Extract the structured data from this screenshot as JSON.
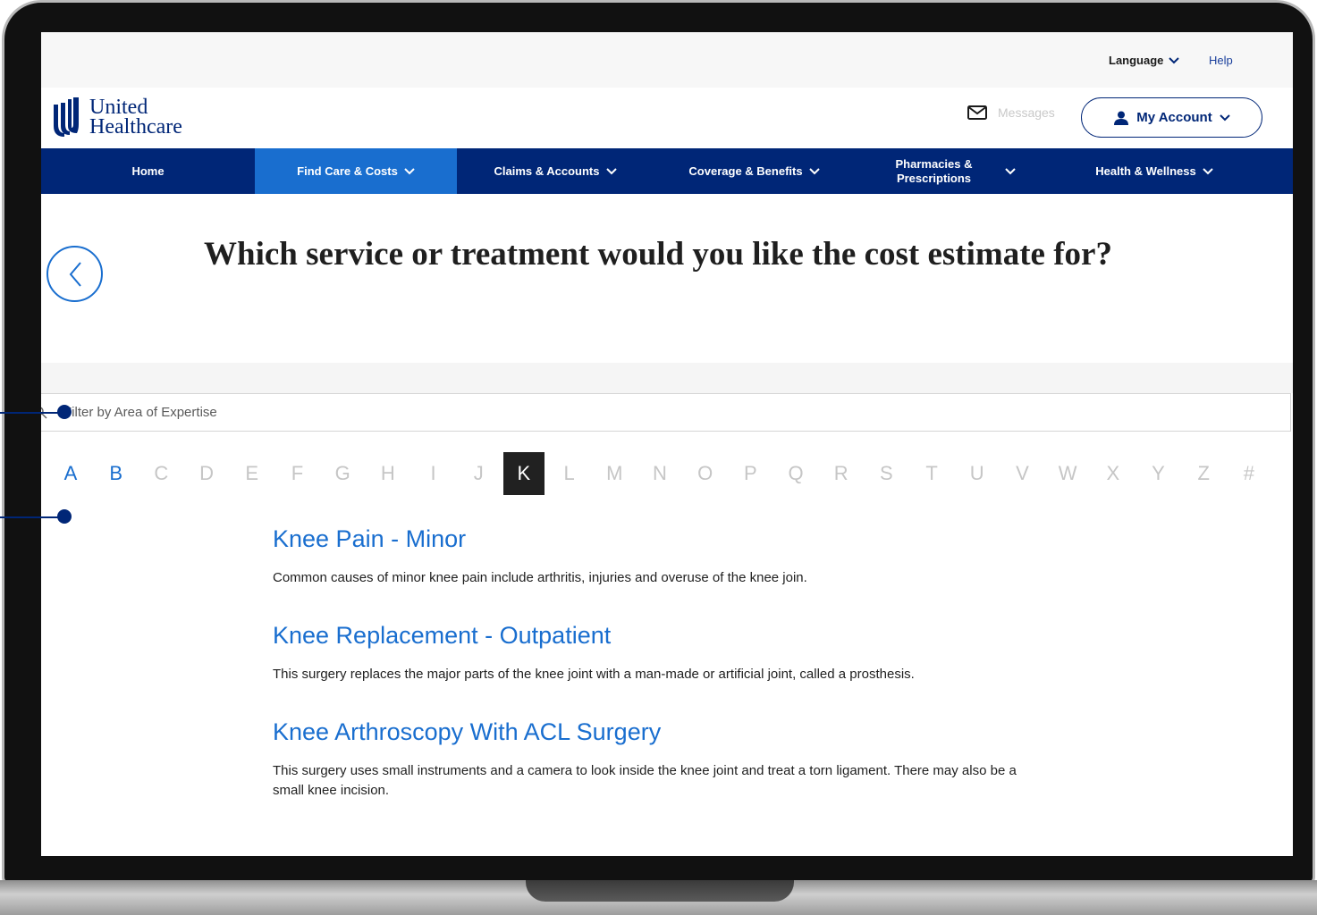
{
  "utility": {
    "language_label": "Language",
    "help_label": "Help"
  },
  "header": {
    "logo_line1": "United",
    "logo_line2": "Healthcare",
    "messages_label": "Messages",
    "account_label": "My Account"
  },
  "nav": {
    "items": [
      {
        "label": "Home"
      },
      {
        "label": "Find Care & Costs"
      },
      {
        "label": "Claims & Accounts"
      },
      {
        "label": "Coverage & Benefits"
      },
      {
        "label_line1": "Pharmacies &",
        "label_line2": "Prescriptions"
      },
      {
        "label": "Health & Wellness"
      }
    ]
  },
  "page": {
    "title": "Which service or treatment would you like the cost estimate for?"
  },
  "filter": {
    "placeholder": "Filter by Area of Expertise"
  },
  "alphabet": {
    "letters": [
      "A",
      "B",
      "C",
      "D",
      "E",
      "F",
      "G",
      "H",
      "I",
      "J",
      "K",
      "L",
      "M",
      "N",
      "O",
      "P",
      "Q",
      "R",
      "S",
      "T",
      "U",
      "V",
      "W",
      "X",
      "Y",
      "Z",
      "#"
    ],
    "enabled": [
      "A",
      "B"
    ],
    "selected": "K"
  },
  "results": [
    {
      "title": "Knee Pain - Minor",
      "description": "Common causes of minor knee pain include arthritis, injuries and overuse of the knee join."
    },
    {
      "title": "Knee Replacement - Outpatient",
      "description": "This surgery replaces the major parts of the knee joint with a man-made or artificial joint, called a prosthesis."
    },
    {
      "title": "Knee Arthroscopy With ACL Surgery",
      "description": "This surgery uses small instruments and a camera to look inside the knee joint and treat a torn ligament. There may also be a small knee incision."
    }
  ],
  "colors": {
    "brand_navy": "#002677",
    "brand_blue": "#196ecf",
    "selected_letter_bg": "#212121"
  }
}
